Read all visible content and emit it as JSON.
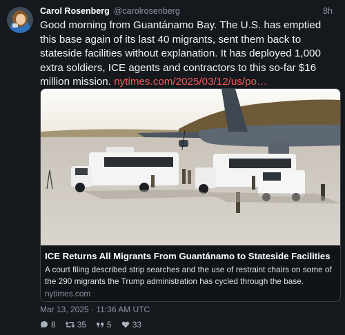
{
  "post": {
    "author_name": "Carol Rosenberg",
    "author_handle": "@carolrosenberg",
    "time_ago": "8h",
    "text_main": "Good morning from Guantánamo Bay. The U.S. has emptied this base again of its last 40 migrants, sent them back to stateside facilities without explanation. It has deployed 1,000 extra soldiers, ICE agents and contractors to this so-far $16 million mission. ",
    "text_link": "nytimes.com/2025/03/12/us/po…",
    "card": {
      "title": "ICE Returns All Migrants From Guantánamo to Stateside Facilities",
      "description": "A court filing described strip searches and the use of restraint chairs on some of the 290 migrants the Trump administration has cycled through the base.",
      "domain": "nytimes.com"
    },
    "timestamp": "Mar 13, 2025 · 11:36 AM UTC",
    "counts": {
      "replies": "8",
      "reposts": "35",
      "quotes": "5",
      "likes": "33"
    }
  }
}
